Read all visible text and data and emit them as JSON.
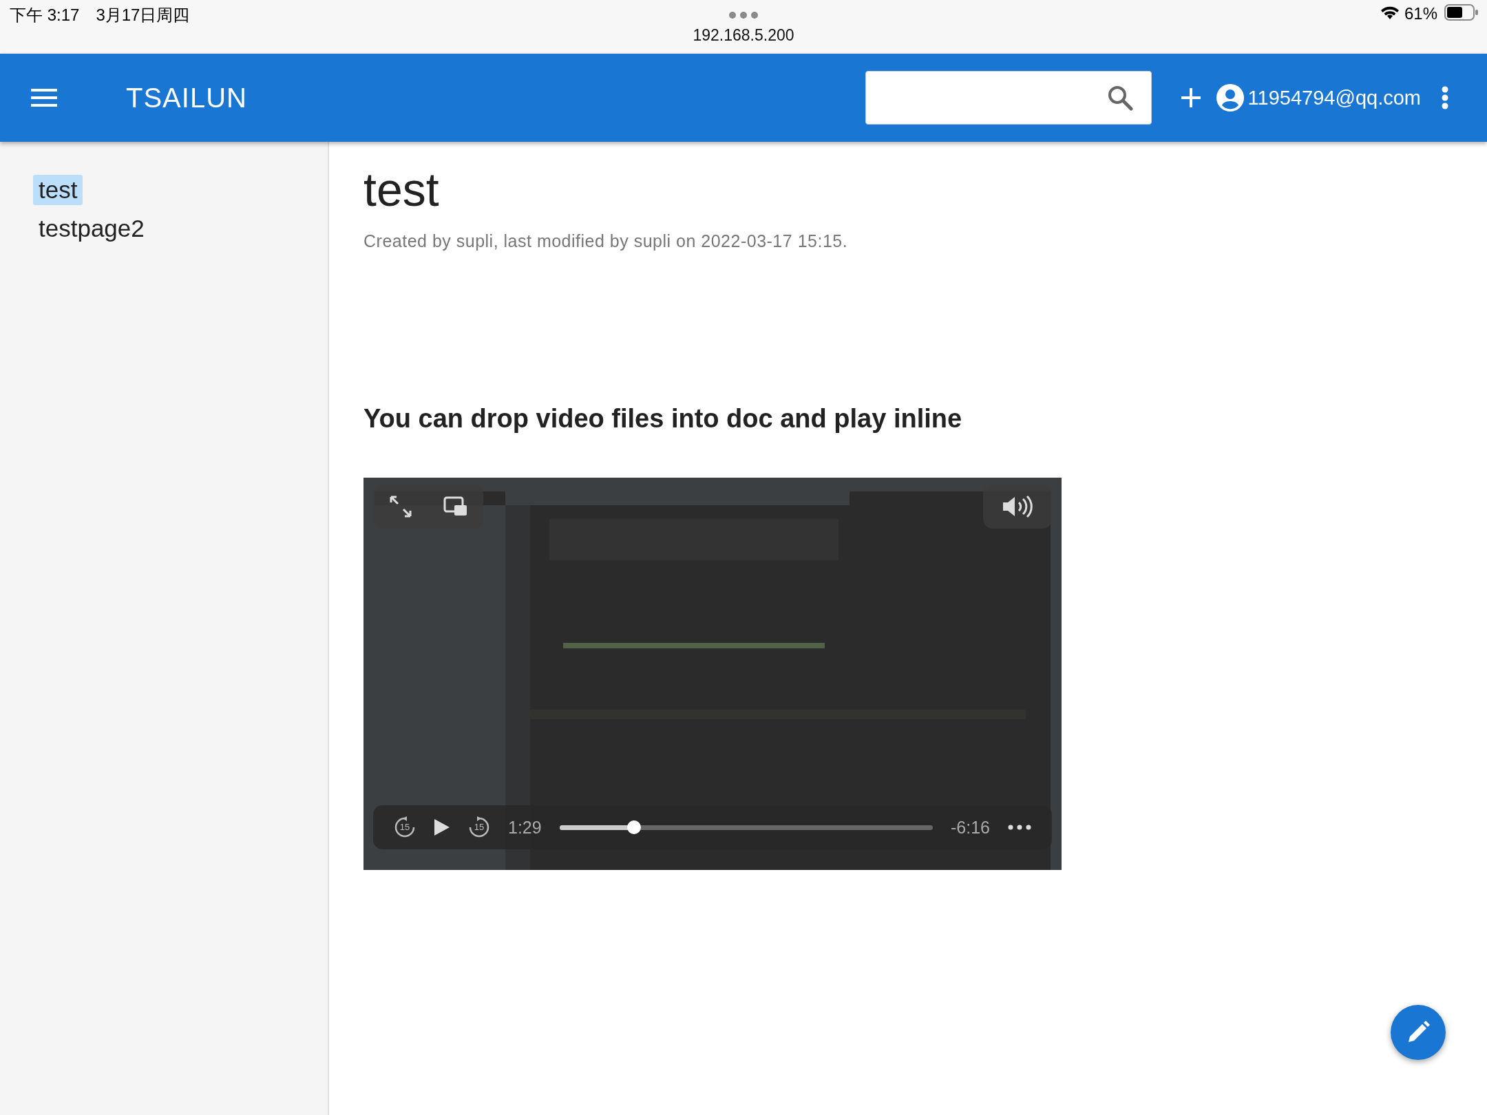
{
  "status_bar": {
    "time": "下午 3:17",
    "date": "3月17日周四",
    "url": "192.168.5.200",
    "battery": "61%"
  },
  "app_bar": {
    "title": "TSAILUN",
    "account": "11954794@qq.com"
  },
  "sidebar": {
    "items": [
      {
        "label": "test",
        "selected": true
      },
      {
        "label": "testpage2",
        "selected": false
      }
    ]
  },
  "page": {
    "title": "test",
    "meta": "Created by supli, last modified by supli on 2022-03-17 15:15.",
    "heading": "You can drop  video files into doc and play inline",
    "video": {
      "kind": "picture",
      "skip_back": "15",
      "skip_forward": "15",
      "elapsed": "1:29",
      "remaining": "-6:16",
      "level": 0.2
    }
  }
}
